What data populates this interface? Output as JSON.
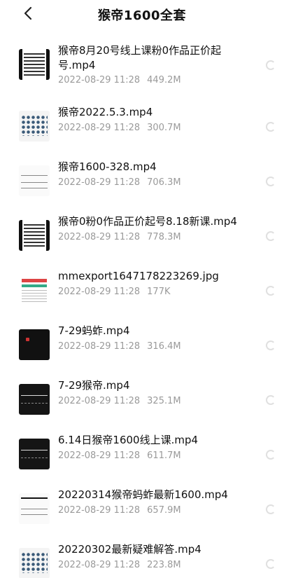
{
  "header": {
    "title": "猴帝1600全套"
  },
  "files": [
    {
      "name": "猴帝8月20号线上课粉0作品正价起号.mp4",
      "date": "2022-08-29 11:28",
      "size": "449.2M",
      "thumb": "doc"
    },
    {
      "name": "猴帝2022.5.3.mp4",
      "date": "2022-08-29 11:28",
      "size": "300.7M",
      "thumb": "grid"
    },
    {
      "name": "猴帝1600-328.mp4",
      "date": "2022-08-29 11:28",
      "size": "706.3M",
      "thumb": "sketch"
    },
    {
      "name": "猴帝0粉0作品正价起号8.18新课.mp4",
      "date": "2022-08-29 11:28",
      "size": "778.3M",
      "thumb": "doc"
    },
    {
      "name": "mmexport1647178223269.jpg",
      "date": "2022-08-29 11:28",
      "size": "177K",
      "thumb": "shot"
    },
    {
      "name": "7-29蚂蚱.mp4",
      "date": "2022-08-29 11:28",
      "size": "316.4M",
      "thumb": "dark"
    },
    {
      "name": "7-29猴帝.mp4",
      "date": "2022-08-29 11:28",
      "size": "325.1M",
      "thumb": "chart"
    },
    {
      "name": "6.14日猴帝1600线上课.mp4",
      "date": "2022-08-29 11:28",
      "size": "611.7M",
      "thumb": "dark"
    },
    {
      "name": "20220314猴帝蚂蚱最新1600.mp4",
      "date": "2022-08-29 11:28",
      "size": "657.9M",
      "thumb": "sketch"
    },
    {
      "name": "20220302最新疑难解答.mp4",
      "date": "2022-08-29 11:28",
      "size": "223.8M",
      "thumb": "grid"
    }
  ]
}
